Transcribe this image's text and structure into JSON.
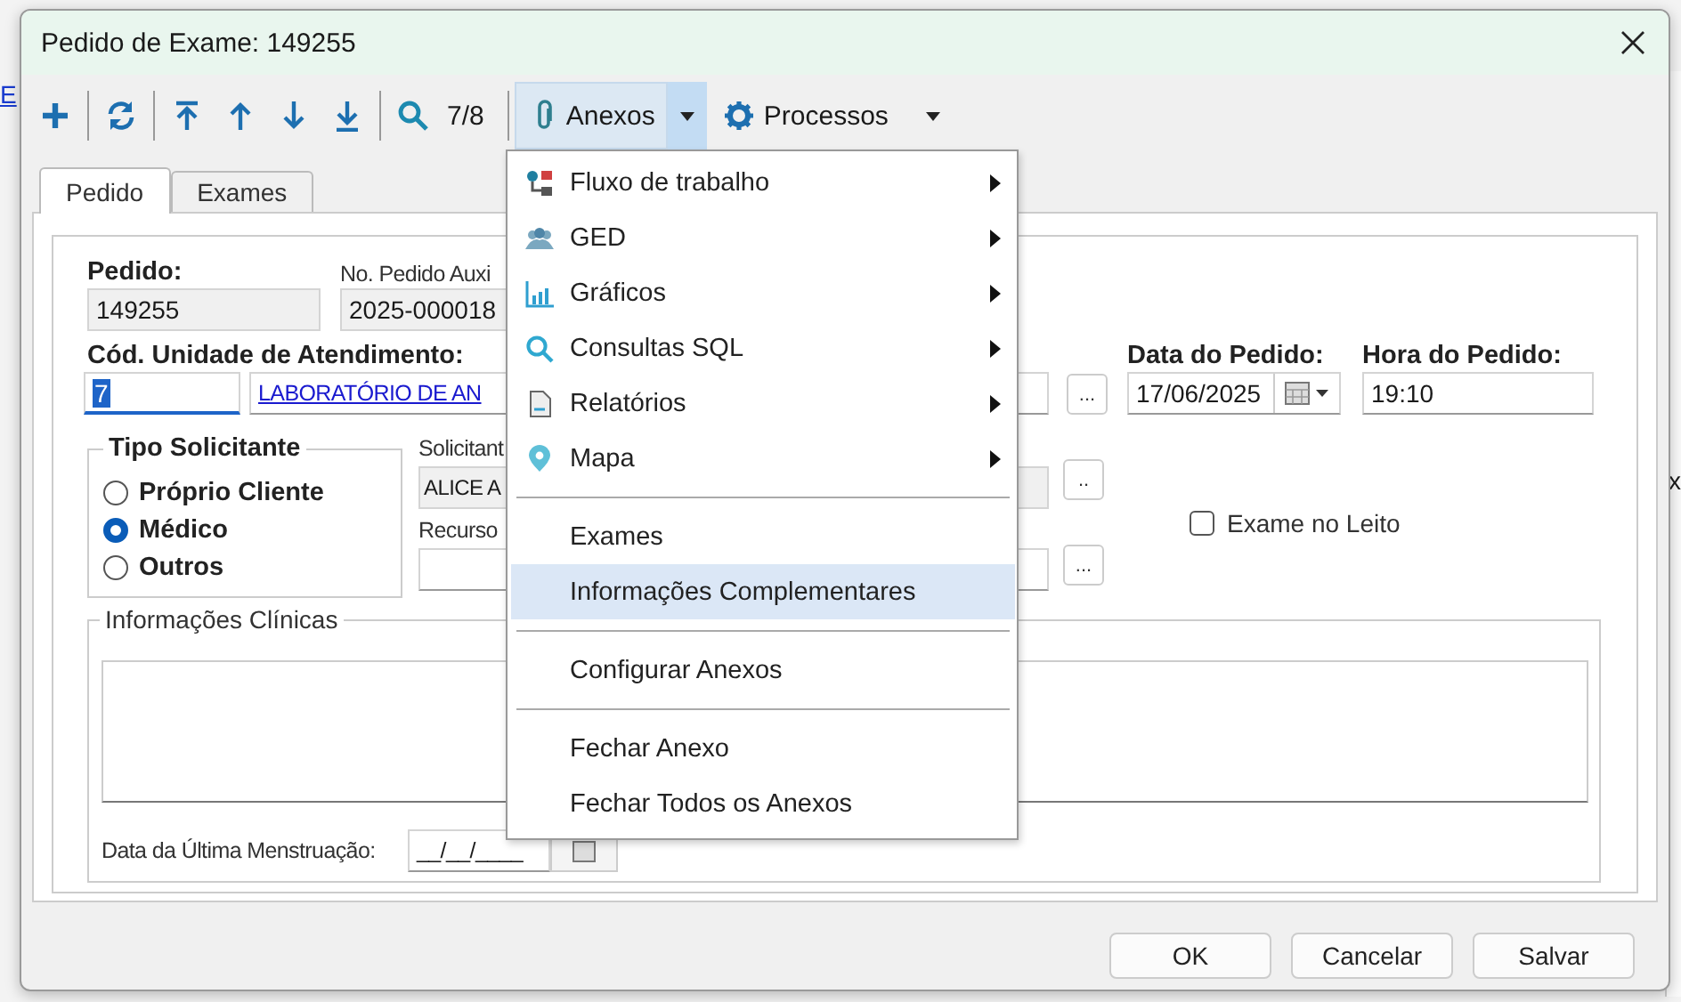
{
  "background": {
    "left": [
      {
        "kind": "link",
        "text": "E"
      }
    ],
    "right": [
      {
        "kind": "text",
        "text": "x"
      }
    ]
  },
  "window": {
    "title": "Pedido de Exame: 149255"
  },
  "toolbar": {
    "counter": "7/8",
    "menus": [
      {
        "label": "Anexos",
        "expanded": true,
        "split": true
      },
      {
        "label": "Processos",
        "expanded": false,
        "split": false
      }
    ]
  },
  "tabs": [
    {
      "label": "Pedido",
      "selected": true
    },
    {
      "label": "Exames",
      "selected": false
    }
  ],
  "form": {
    "pedido": {
      "label": "Pedido:",
      "value": "149255"
    },
    "pedido_aux": {
      "label": "No. Pedido Auxi",
      "value": "2025-000018"
    },
    "unidade": {
      "label": "Cód. Unidade de Atendimento:",
      "code": "7",
      "code_highlighted": true,
      "name": "LABORATÓRIO DE AN"
    },
    "lookup_buttons": [
      "...",
      "..",
      "..."
    ],
    "data_pedido": {
      "label": "Data do Pedido:",
      "value": "17/06/2025"
    },
    "hora_pedido": {
      "label": "Hora do Pedido:",
      "value": "19:10"
    },
    "tipo_solicitante": {
      "title": "Tipo Solicitante",
      "options": [
        {
          "label": "Próprio Cliente",
          "selected": false
        },
        {
          "label": "Médico",
          "selected": true
        },
        {
          "label": "Outros",
          "selected": false
        }
      ]
    },
    "solicitante": {
      "label": "Solicitant",
      "value": "ALICE A"
    },
    "recurso": {
      "label": "Recurso"
    },
    "exame_no_leito": {
      "label": "Exame no Leito",
      "checked": false
    },
    "informacoes_clinicas": {
      "title": "Informações Clínicas"
    },
    "menstruacao": {
      "label": "Data da Última Menstruação:",
      "value": "__/__/____"
    }
  },
  "menu": {
    "items": [
      {
        "kind": "submenu",
        "label": "Fluxo de trabalho",
        "selected": false
      },
      {
        "kind": "submenu",
        "label": "GED",
        "selected": false
      },
      {
        "kind": "submenu",
        "label": "Gráficos",
        "selected": false
      },
      {
        "kind": "submenu",
        "label": "Consultas SQL",
        "selected": false
      },
      {
        "kind": "submenu",
        "label": "Relatórios",
        "selected": false
      },
      {
        "kind": "submenu",
        "label": "Mapa",
        "selected": false
      },
      {
        "kind": "separator"
      },
      {
        "kind": "item",
        "label": "Exames",
        "selected": false
      },
      {
        "kind": "item",
        "label": "Informações Complementares",
        "selected": true
      },
      {
        "kind": "separator"
      },
      {
        "kind": "item",
        "label": "Configurar Anexos",
        "selected": false
      },
      {
        "kind": "separator"
      },
      {
        "kind": "item",
        "label": "Fechar Anexo",
        "selected": false
      },
      {
        "kind": "item",
        "label": "Fechar Todos os Anexos",
        "selected": false
      }
    ]
  },
  "buttons": [
    "OK",
    "Cancelar",
    "Salvar"
  ]
}
